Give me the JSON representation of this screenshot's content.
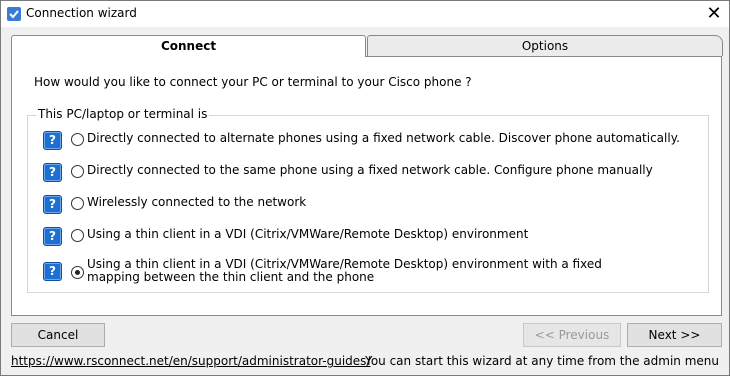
{
  "window": {
    "title": "Connection wizard",
    "close_glyph": "✕"
  },
  "tabs": [
    {
      "label": "Connect",
      "active": true
    },
    {
      "label": "Options",
      "active": false
    }
  ],
  "question": "How would you like to connect your PC or terminal to your Cisco phone ?",
  "group": {
    "label": "This PC/laptop or terminal is",
    "options": [
      {
        "label": "Directly connected to alternate phones using a fixed network cable. Discover phone automatically.",
        "checked": false
      },
      {
        "label": "Directly connected to the same phone using a fixed network cable. Configure phone manually",
        "checked": false
      },
      {
        "label": "Wirelessly connected to the network",
        "checked": false
      },
      {
        "label": "Using a thin client in a VDI (Citrix/VMWare/Remote Desktop) environment",
        "checked": false
      },
      {
        "label": "Using a thin client in a VDI (Citrix/VMWare/Remote Desktop) environment with a fixed",
        "label_line2": "mapping between the thin client and the phone",
        "checked": true
      }
    ]
  },
  "help_glyph": "?",
  "buttons": {
    "cancel": "Cancel",
    "previous": "<< Previous",
    "next": "Next >>"
  },
  "footer": {
    "link": "https://www.rsconnect.net/en/support/administrator-guides/",
    "hint": "You can start this wizard at any time from the admin menu"
  },
  "colors": {
    "help_icon": "#1e6fd0",
    "app_icon": "#3a7bd5"
  }
}
